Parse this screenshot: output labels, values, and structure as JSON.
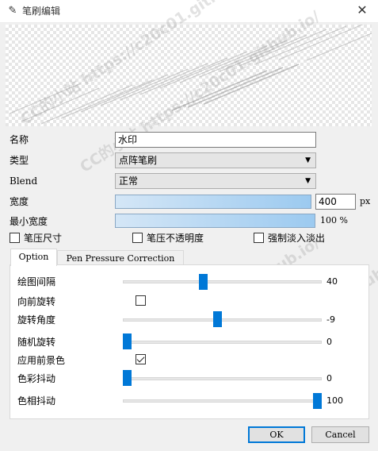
{
  "window": {
    "title": "笔刷编辑",
    "close_icon": "close-icon",
    "app_icon": "brush-app-icon"
  },
  "watermark_text": "CC的小站 https://c20c01.github.io/",
  "form": {
    "name_label": "名称",
    "name_value": "水印",
    "type_label": "类型",
    "type_value": "点阵笔刷",
    "blend_label": "Blend",
    "blend_value": "正常",
    "width_label": "宽度",
    "width_value": "400",
    "width_unit": "px",
    "min_width_label": "最小宽度",
    "min_width_value": "100 %",
    "pressure_size_label": "笔压尺寸",
    "pressure_size_checked": false,
    "pressure_opacity_label": "笔压不透明度",
    "pressure_opacity_checked": false,
    "force_fade_label": "强制淡入淡出",
    "force_fade_checked": false
  },
  "tabs": [
    {
      "label": "Option",
      "active": true
    },
    {
      "label": "Pen Pressure Correction",
      "active": false
    }
  ],
  "options": {
    "spacing": {
      "label": "绘图间隔",
      "value": "40",
      "min": 0,
      "max": 100,
      "level": 40
    },
    "forward_rotate": {
      "label": "向前旋转",
      "checked": false
    },
    "rotation_angle": {
      "label": "旋转角度",
      "value": "-9",
      "min": -180,
      "max": 180,
      "level": -9
    },
    "random_rotate": {
      "label": "随机旋转",
      "value": "0",
      "min": 0,
      "max": 100,
      "level": 0
    },
    "apply_foreground": {
      "label": "应用前景色",
      "checked": true
    },
    "color_jitter": {
      "label": "色彩抖动",
      "value": "0",
      "min": 0,
      "max": 100,
      "level": 0
    },
    "hue_jitter": {
      "label": "色相抖动",
      "value": "100",
      "min": 0,
      "max": 100,
      "level": 100
    }
  },
  "buttons": {
    "ok": "OK",
    "cancel": "Cancel"
  },
  "colors": {
    "accent": "#0078d7",
    "window_bg": "#f0f0f0"
  }
}
